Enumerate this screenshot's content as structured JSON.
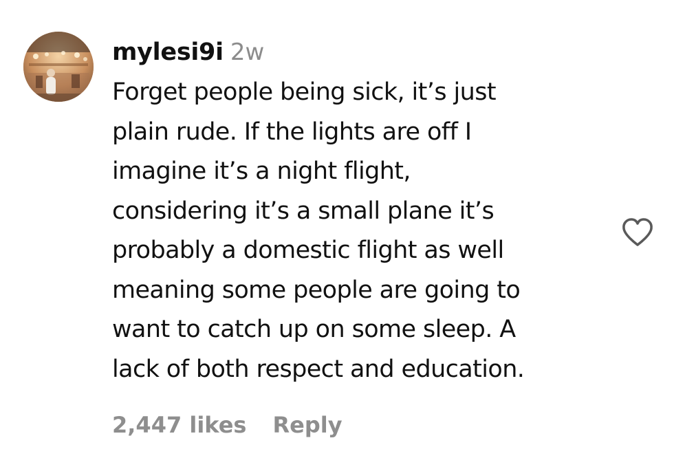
{
  "comment": {
    "username": "mylesi9i",
    "time_ago": "2w",
    "text_lines": [
      "Forget people being sick, it’s just",
      "plain rude. If the lights are off I",
      "imagine it’s a night flight,",
      "considering it’s a small plane it’s",
      "probably a domestic flight as well",
      "meaning some people are going to",
      "want to catch up on some sleep. A",
      "lack of both respect and education."
    ],
    "likes_label": "2,447 likes",
    "reply_label": "Reply",
    "like_icon": "heart-outline-icon"
  },
  "colors": {
    "text": "#111111",
    "muted": "#8e8e8e",
    "background": "#ffffff"
  }
}
